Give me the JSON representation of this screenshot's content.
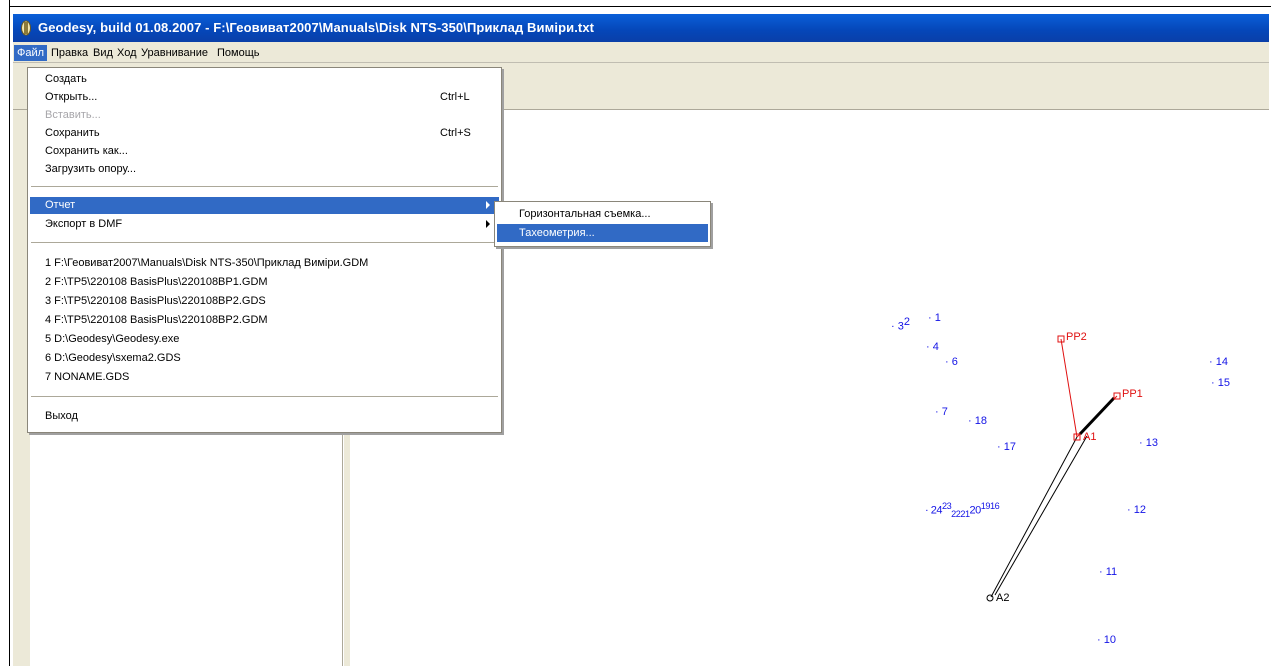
{
  "window": {
    "title": "Geodesy, build 01.08.2007 - F:\\Геовиват2007\\Manuals\\Disk NTS-350\\Приклад Виміри.txt",
    "icon": "app-icon"
  },
  "menubar": {
    "items": [
      "Файл",
      "Правка",
      "Вид",
      "Ход",
      "Уравнивание",
      "Помощь"
    ]
  },
  "file_menu": {
    "items": [
      {
        "label": "Создать",
        "shortcut": ""
      },
      {
        "label": "Открыть...",
        "shortcut": "Ctrl+L"
      },
      {
        "label": "Вставить...",
        "shortcut": "",
        "disabled": true
      },
      {
        "label": "Сохранить",
        "shortcut": "Ctrl+S"
      },
      {
        "label": "Сохранить как...",
        "shortcut": ""
      },
      {
        "label": "Загрузить опору...",
        "shortcut": ""
      },
      {
        "label": "Отчет",
        "submenu": true,
        "highlighted": true
      },
      {
        "label": "Экспорт в DMF",
        "submenu": true
      },
      {
        "label": "1 F:\\Геовиват2007\\Manuals\\Disk NTS-350\\Приклад Виміри.GDM"
      },
      {
        "label": "2 F:\\TP5\\220108 BasisPlus\\220108BP1.GDM"
      },
      {
        "label": "3 F:\\TP5\\220108 BasisPlus\\220108BP2.GDS"
      },
      {
        "label": "4 F:\\TP5\\220108 BasisPlus\\220108BP2.GDM"
      },
      {
        "label": "5 D:\\Geodesy\\Geodesy.exe"
      },
      {
        "label": "6 D:\\Geodesy\\sxema2.GDS"
      },
      {
        "label": "7 NONAME.GDS"
      },
      {
        "label": "Выход"
      }
    ]
  },
  "report_submenu": {
    "items": [
      "Горизонтальная съемка...",
      "Тахеометрия..."
    ],
    "highlighted_index": 1
  },
  "plot": {
    "points_blue": [
      "3",
      "2",
      "1",
      "4",
      "6",
      "7",
      "18",
      "17",
      "14",
      "15",
      "13",
      "24",
      "23",
      "22",
      "21",
      "20",
      "19",
      "16",
      "12",
      "11",
      "10"
    ],
    "points_red": [
      "PP2",
      "PP1",
      "A1"
    ],
    "points_black": [
      "A2"
    ],
    "colors": {
      "points": "#1414e6",
      "control": "#e01010",
      "traverse": "#000000",
      "highlight": "#316ac5"
    }
  }
}
